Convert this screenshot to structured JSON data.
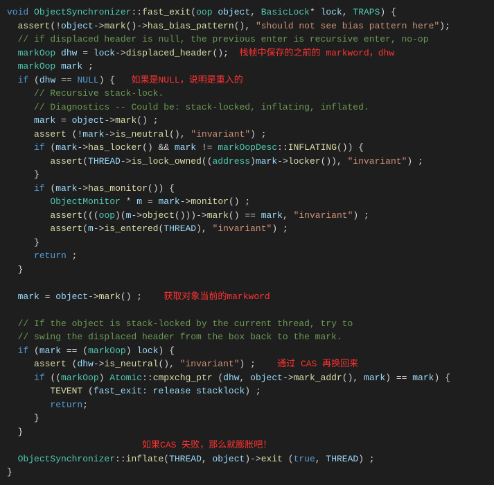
{
  "code": {
    "l01_void": "void",
    "l01_class": "ObjectSynchronizer",
    "l01_fn": "fast_exit",
    "l01_p1t": "oop",
    "l01_p1n": "object",
    "l01_p2t": "BasicLock",
    "l01_p2n": "lock",
    "l01_traps": "TRAPS",
    "l02_assert": "assert",
    "l02_obj": "object",
    "l02_mark": "mark",
    "l02_hbp": "has_bias_pattern",
    "l02_str": "\"should not see bias pattern here\"",
    "l03_cmt": "// if displaced header is null, the previous enter is recursive enter, no-op",
    "l04_type": "markOop",
    "l04_dhw": "dhw",
    "l04_lock": "lock",
    "l04_disp": "displaced_header",
    "l04_note": "栈帧中保存的之前的 markword，dhw",
    "l05_type": "markOop",
    "l05_mark": "mark",
    "l06_if": "if",
    "l06_dhw": "dhw",
    "l06_null": "NULL",
    "l06_note": "如果是NULL，说明是重入的",
    "l07_cmt": "// Recursive stack-lock.",
    "l08_cmt": "// Diagnostics -- Could be: stack-locked, inflating, inflated.",
    "l09_mark": "mark",
    "l09_obj": "object",
    "l09_markfn": "mark",
    "l10_assert": "assert",
    "l10_mark": "mark",
    "l10_isn": "is_neutral",
    "l10_str": "\"invariant\"",
    "l11_if": "if",
    "l11_mark": "mark",
    "l11_hl": "has_locker",
    "l11_mark2": "mark",
    "l11_mod": "markOopDesc",
    "l11_infl": "INFLATING",
    "l12_assert": "assert",
    "l12_thread": "THREAD",
    "l12_ilo": "is_lock_owned",
    "l12_addr": "address",
    "l12_mark": "mark",
    "l12_locker": "locker",
    "l12_str": "\"invariant\"",
    "l14_if": "if",
    "l14_mark": "mark",
    "l14_hm": "has_monitor",
    "l15_type": "ObjectMonitor",
    "l15_m": "m",
    "l15_mark": "mark",
    "l15_mon": "monitor",
    "l16_assert": "assert",
    "l16_oop": "oop",
    "l16_m": "m",
    "l16_obj": "object",
    "l16_markfn": "mark",
    "l16_mark": "mark",
    "l16_str": "\"invariant\"",
    "l17_assert": "assert",
    "l17_m": "m",
    "l17_ie": "is_entered",
    "l17_thread": "THREAD",
    "l17_str": "\"invariant\"",
    "l19_return": "return",
    "l22_mark": "mark",
    "l22_obj": "object",
    "l22_markfn": "mark",
    "l22_note": "获取对象当前的markword",
    "l24_cmt": "// If the object is stack-locked by the current thread, try to",
    "l25_cmt": "// swing the displaced header from the box back to the mark.",
    "l26_if": "if",
    "l26_mark": "mark",
    "l26_markoop": "markOop",
    "l26_lock": "lock",
    "l27_assert": "assert",
    "l27_dhw": "dhw",
    "l27_isn": "is_neutral",
    "l27_str": "\"invariant\"",
    "l27_note": "通过 CAS 再换回来",
    "l28_if": "if",
    "l28_markoop": "markOop",
    "l28_atomic": "Atomic",
    "l28_cmp": "cmpxchg_ptr",
    "l28_dhw": "dhw",
    "l28_obj": "object",
    "l28_ma": "mark_addr",
    "l28_mark": "mark",
    "l28_mark2": "mark",
    "l29_tevent": "TEVENT",
    "l29_msg": "fast_exit: release stacklock",
    "l30_return": "return",
    "l33_note": "如果CAS 失败，那么就膨胀吧！",
    "l34_class": "ObjectSynchronizer",
    "l34_infl": "inflate",
    "l34_thread": "THREAD",
    "l34_obj": "object",
    "l34_exit": "exit",
    "l34_true": "true",
    "l34_thread2": "THREAD"
  }
}
